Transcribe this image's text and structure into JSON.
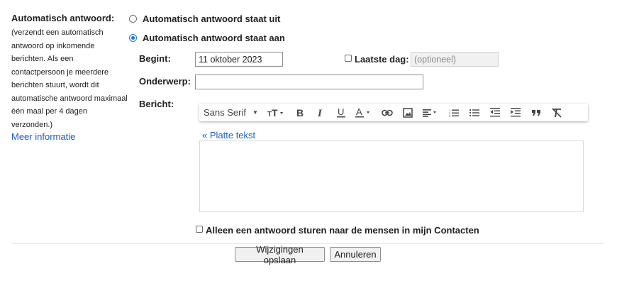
{
  "left": {
    "title": "Automatisch antwoord:",
    "description_lines": [
      "(verzendt een automatisch",
      "antwoord op inkomende",
      "berichten. Als een",
      "contactpersoon je meerdere",
      "berichten stuurt, wordt dit",
      "automatische antwoord maximaal",
      "één maal per 4 dagen",
      "verzonden.)"
    ],
    "more_link": "Meer informatie"
  },
  "options": {
    "off_label": "Automatisch antwoord staat uit",
    "on_label": "Automatisch antwoord staat aan",
    "selected": "on"
  },
  "form": {
    "start_label": "Begint:",
    "start_value": "11 oktober 2023",
    "last_day_label": "Laatste dag:",
    "last_day_placeholder": "(optioneel)",
    "last_day_checked": false,
    "subject_label": "Onderwerp:",
    "subject_value": "",
    "message_label": "Bericht:"
  },
  "toolbar": {
    "font": "Sans Serif",
    "icons": [
      "font-size-icon",
      "bold-icon",
      "italic-icon",
      "underline-icon",
      "text-color-icon",
      "link-icon",
      "image-icon",
      "align-icon",
      "numbered-list-icon",
      "bulleted-list-icon",
      "indent-less-icon",
      "indent-more-icon",
      "quote-icon",
      "remove-formatting-icon"
    ]
  },
  "editor": {
    "plain_text_link": "« Platte tekst",
    "body": ""
  },
  "contacts_only": {
    "label": "Alleen een antwoord sturen naar de mensen in mijn Contacten",
    "checked": false
  },
  "buttons": {
    "save": "Wijzigingen opslaan",
    "cancel": "Annuleren"
  },
  "colors": {
    "link": "#1a5ec0",
    "radio_accent": "#1a73e8"
  }
}
